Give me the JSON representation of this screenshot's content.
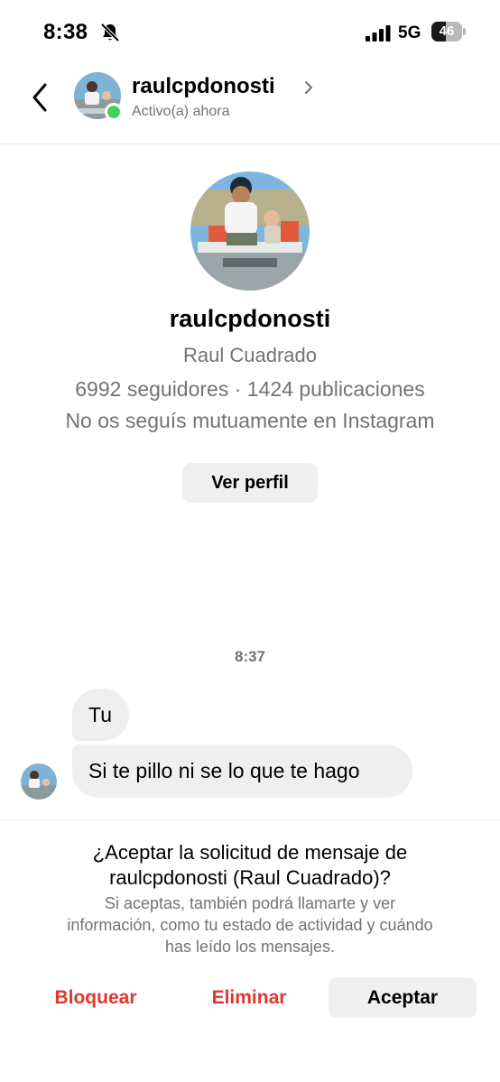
{
  "status_bar": {
    "time": "8:38",
    "network": "5G",
    "battery_level": "46",
    "battery_fraction": 0.46,
    "icons": [
      "bell-slash-icon",
      "signal-bars-icon",
      "battery-icon"
    ]
  },
  "header": {
    "username": "raulcpdonosti",
    "status": "Activo(a) ahora",
    "online_color": "#3fd15a",
    "icons": [
      "back-chevron-icon",
      "chevron-right-icon"
    ]
  },
  "profile": {
    "username": "raulcpdonosti",
    "full_name": "Raul Cuadrado",
    "stats": "6992 seguidores · 1424 publicaciones",
    "mutual": "No os seguís mutuamente en Instagram",
    "view_profile_label": "Ver perfil"
  },
  "messages": {
    "timestamp": "8:37",
    "items": [
      {
        "text": "Tu"
      },
      {
        "text": "Si te pillo ni se lo que te hago"
      }
    ]
  },
  "request": {
    "title_line1": "¿Aceptar la solicitud de mensaje de",
    "title_line2": "raulcpdonosti (Raul Cuadrado)?",
    "desc_line1": "Si aceptas, también podrá llamarte y ver",
    "desc_line2": "información, como tu estado de actividad y cuándo",
    "desc_line3": "has leído los mensajes.",
    "block_label": "Bloquear",
    "delete_label": "Eliminar",
    "accept_label": "Aceptar",
    "danger_color": "#e0362c"
  }
}
